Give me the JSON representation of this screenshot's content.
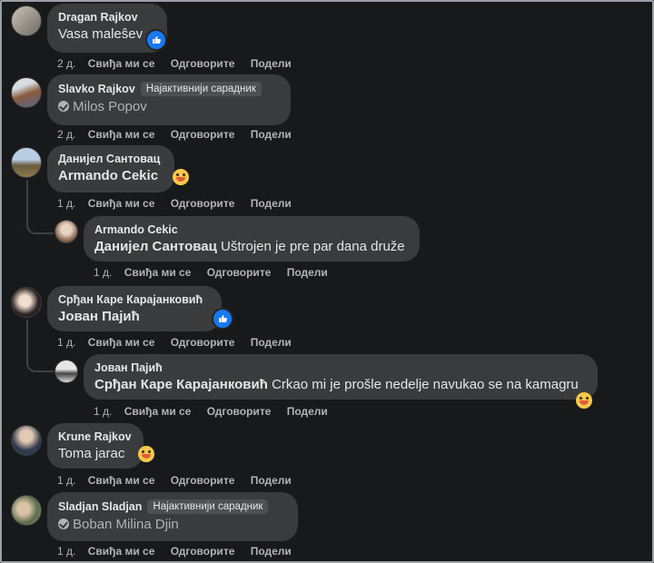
{
  "actions": {
    "like": "Свиђа ми се",
    "reply": "Одговорите",
    "share": "Подели"
  },
  "badge_top_contributor": "Најактивнији сарадник",
  "comments": [
    {
      "author": "Dragan Rajkov",
      "text": "Vasa maleŝev",
      "time": "2 д."
    },
    {
      "author": "Slavko Rajkov",
      "text": "Milos Popov",
      "time": "2 д."
    },
    {
      "author": "Данијел Сантовац",
      "text": "Armando Cekic",
      "time": "1 д."
    },
    {
      "author": "Armando Cekic",
      "mention": "Данијел Сантовац",
      "text": " Uštrojen je pre par dana druže",
      "time": "1 д."
    },
    {
      "author": "Срђан Каре Карајанковић",
      "text": "Јован Пајић",
      "time": "1 д."
    },
    {
      "author": "Јован Пајић",
      "mention": "Срђан Каре Карајанковић",
      "text": " Crkao mi je prošle nedelje navukao se na kamagru",
      "time": "1 д."
    },
    {
      "author": "Krune Rajkov",
      "text": "Toma jarac",
      "time": "1 д."
    },
    {
      "author": "Sladjan Sladjan",
      "text": "Boban Milina Djin",
      "time": "1 д."
    }
  ],
  "colors": {
    "background": "#18191a",
    "bubble": "#3a3b3c",
    "like_blue": "#1877f2",
    "muted": "#b0b3b8"
  }
}
